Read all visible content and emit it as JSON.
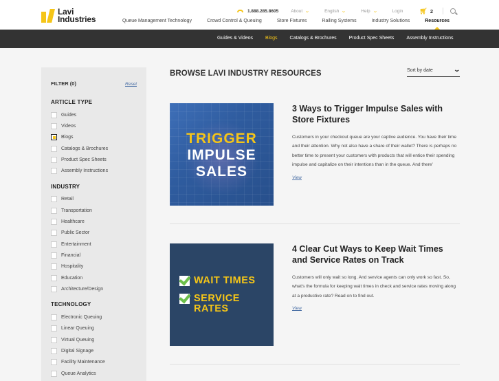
{
  "header": {
    "logo": {
      "line1": "Lavi",
      "line2": "Industries"
    },
    "phone": "1.888.285.8605",
    "util": {
      "about": "About",
      "language": "English",
      "help": "Help",
      "login": "Login",
      "cart_count": "2"
    },
    "nav": [
      {
        "label": "Queue Management Technology"
      },
      {
        "label": "Crowd Control & Queuing"
      },
      {
        "label": "Store Fixtures"
      },
      {
        "label": "Railing Systems"
      },
      {
        "label": "Industry Solutions"
      },
      {
        "label": "Resources"
      }
    ]
  },
  "subnav": [
    {
      "label": "Guides & Videos"
    },
    {
      "label": "Blogs"
    },
    {
      "label": "Catalogs & Brochures"
    },
    {
      "label": "Product Spec Sheets"
    },
    {
      "label": "Assembly Instructions"
    }
  ],
  "sidebar": {
    "filter_title": "FILTER (0)",
    "reset_label": "Reset",
    "groups": [
      {
        "title": "ARTICLE TYPE",
        "items": [
          {
            "label": "Guides",
            "checked": false
          },
          {
            "label": "Videos",
            "checked": false
          },
          {
            "label": "Blogs",
            "checked": true
          },
          {
            "label": "Catalogs & Brochures",
            "checked": false
          },
          {
            "label": "Product Spec Sheets",
            "checked": false
          },
          {
            "label": "Assembly Instructions",
            "checked": false
          }
        ]
      },
      {
        "title": "INDUSTRY",
        "items": [
          {
            "label": "Retail",
            "checked": false
          },
          {
            "label": "Transportation",
            "checked": false
          },
          {
            "label": "Healthcare",
            "checked": false
          },
          {
            "label": "Public Sector",
            "checked": false
          },
          {
            "label": "Entertainment",
            "checked": false
          },
          {
            "label": "Financial",
            "checked": false
          },
          {
            "label": "Hospitality",
            "checked": false
          },
          {
            "label": "Education",
            "checked": false
          },
          {
            "label": "Architecture/Design",
            "checked": false
          }
        ]
      },
      {
        "title": "TECHNOLOGY",
        "items": [
          {
            "label": "Electronic Queuing",
            "checked": false
          },
          {
            "label": "Linear Queuing",
            "checked": false
          },
          {
            "label": "Virtual Queuing",
            "checked": false
          },
          {
            "label": "Digital Signage",
            "checked": false
          },
          {
            "label": "Facility Maintenance",
            "checked": false
          },
          {
            "label": "Queue Analytics",
            "checked": false
          }
        ]
      }
    ]
  },
  "main": {
    "title": "BROWSE LAVI INDUSTRY RESOURCES",
    "sort_label": "Sort by date",
    "articles": [
      {
        "title": "3 Ways to Trigger Impulse Sales with Store Fixtures",
        "excerpt": "Customers in your checkout queue are your captive audience. You have their time and their attention. Why not also have a share of their wallet? There is perhaps no better time to present your customers with products that will entice their spending impulse and capitalize on their intentions than in the queue. And there'",
        "view_label": "View",
        "thumb_lines": [
          "TRIGGER",
          "IMPULSE",
          "SALES"
        ]
      },
      {
        "title": "4 Clear Cut Ways to Keep Wait Times and Service Rates on Track",
        "excerpt": "Customers will only wait so long. And service agents can only work so fast. So, what's the formula for keeping wait times in check and service rates moving along at a productive rate? Read on to find out.",
        "view_label": "View",
        "thumb_lines": [
          "WAIT TIMES",
          "SERVICE",
          "RATES"
        ]
      }
    ]
  },
  "colors": {
    "accent": "#f5c518",
    "subnav_bg": "#333333",
    "sidebar_bg": "#e9e9e9",
    "link": "#4a6fa5",
    "thumb2_bg": "#2b4566",
    "check_green": "#6cc04a"
  },
  "icons": [
    "logo-mark-icon",
    "phone-icon",
    "chevron-down-icon",
    "cart-icon",
    "search-icon",
    "checkbox-icon",
    "checkmark-icon"
  ]
}
